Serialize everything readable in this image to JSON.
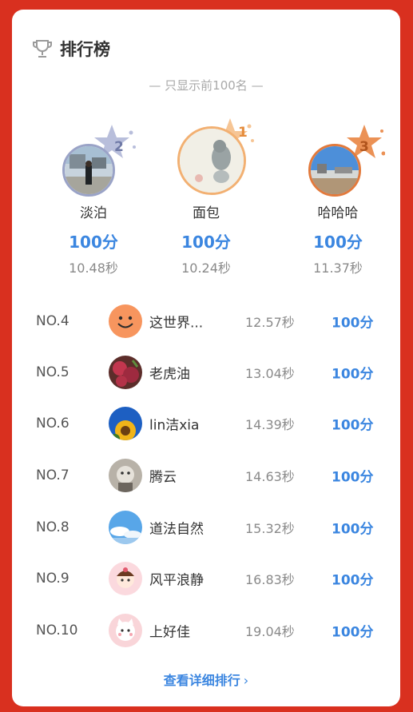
{
  "header": {
    "title": "排行榜",
    "subtitle": "— 只显示前100名 —"
  },
  "podium": [
    {
      "rank": "2",
      "name": "淡泊",
      "score": "100分",
      "time": "10.48秒",
      "accent": "#9aa3c7"
    },
    {
      "rank": "1",
      "name": "面包",
      "score": "100分",
      "time": "10.24秒",
      "accent": "#f2b072"
    },
    {
      "rank": "3",
      "name": "哈哈哈",
      "score": "100分",
      "time": "11.37秒",
      "accent": "#e27a3c"
    }
  ],
  "list": [
    {
      "rank": "NO.4",
      "name": "这世界...",
      "time": "12.57秒",
      "score": "100分"
    },
    {
      "rank": "NO.5",
      "name": "老虎油",
      "time": "13.04秒",
      "score": "100分"
    },
    {
      "rank": "NO.6",
      "name": "lin洁xia",
      "time": "14.39秒",
      "score": "100分"
    },
    {
      "rank": "NO.7",
      "name": "腾云",
      "time": "14.63秒",
      "score": "100分"
    },
    {
      "rank": "NO.8",
      "name": "道法自然",
      "time": "15.32秒",
      "score": "100分"
    },
    {
      "rank": "NO.9",
      "name": "风平浪静",
      "time": "16.83秒",
      "score": "100分"
    },
    {
      "rank": "NO.10",
      "name": "上好佳",
      "time": "19.04秒",
      "score": "100分"
    }
  ],
  "footer": {
    "more_label": "查看详细排行"
  },
  "colors": {
    "background": "#d9301f",
    "accent": "#3b86e0"
  }
}
